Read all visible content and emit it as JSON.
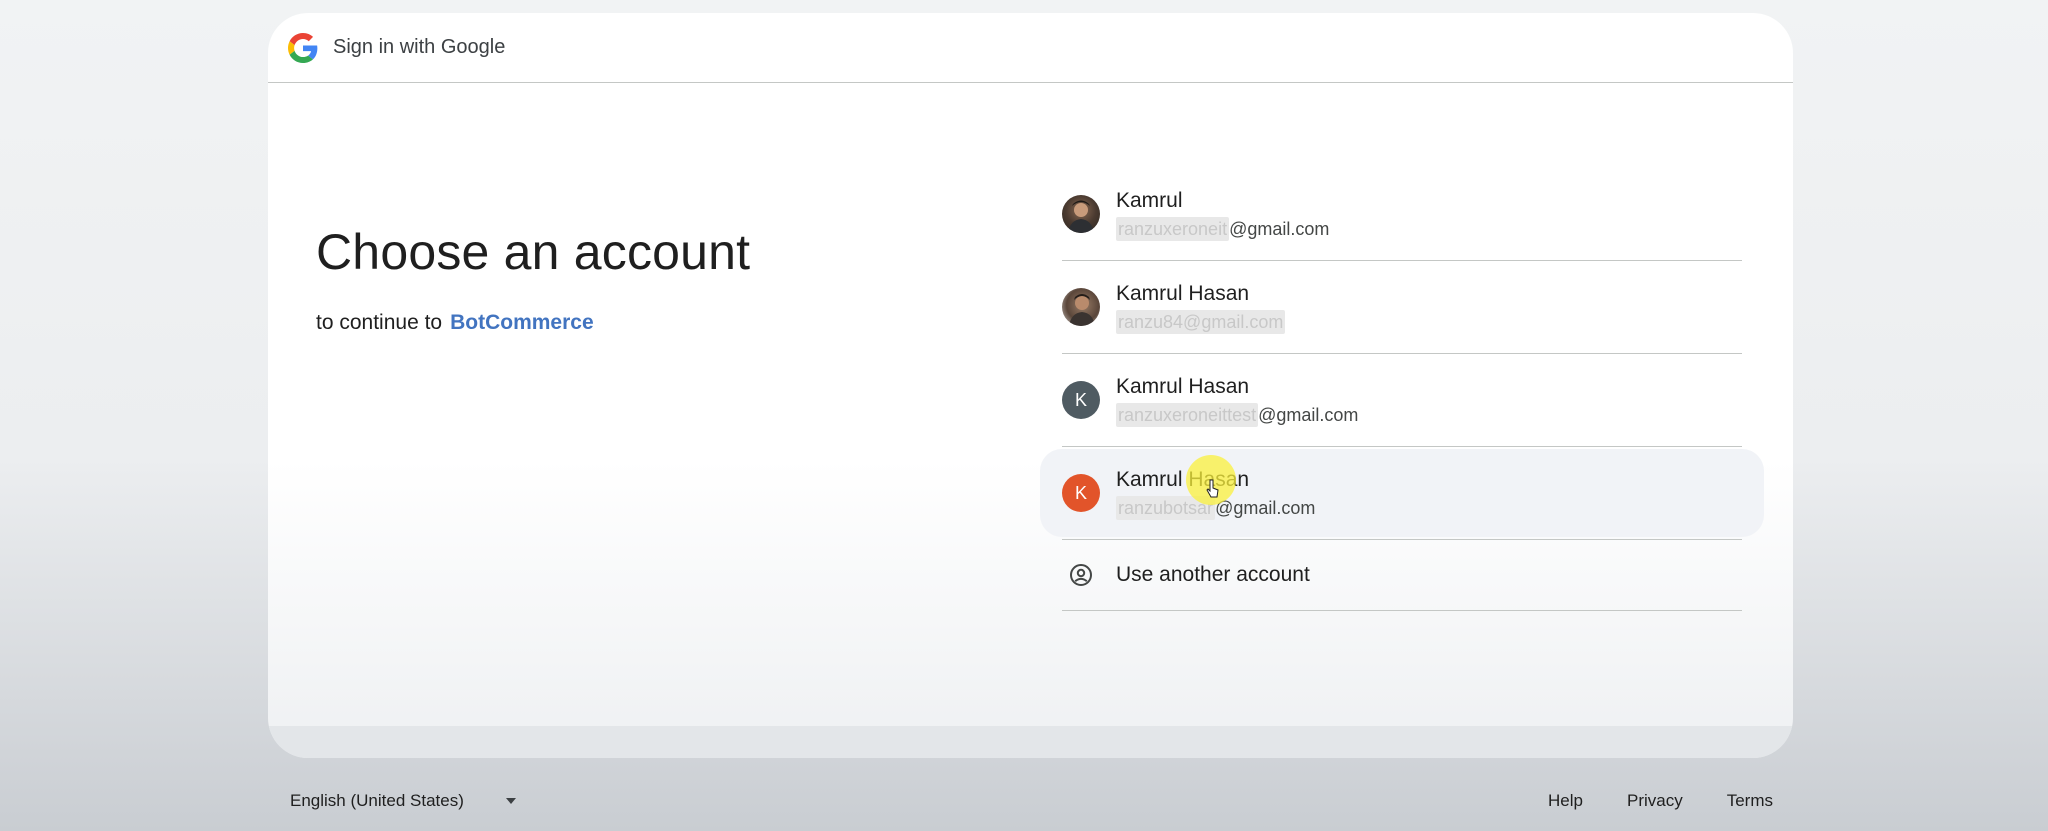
{
  "header": {
    "title": "Sign in with Google",
    "logo_icon": "google-g-icon"
  },
  "main": {
    "title": "Choose an account",
    "subtitle_prefix": "to continue to",
    "app_name": "BotCommerce"
  },
  "accounts": [
    {
      "name": "Kamrul",
      "email_hidden": "ranzuxeroneit",
      "email_visible": "@gmail.com",
      "avatar": "photo"
    },
    {
      "name": "Kamrul Hasan",
      "email_hidden": "ranzu84@gmail.com",
      "email_visible": "",
      "avatar": "photo"
    },
    {
      "name": "Kamrul Hasan",
      "email_hidden": "ranzuxeroneittest",
      "email_visible": "@gmail.com",
      "avatar_letter": "K",
      "avatar_color": "#4f5b62"
    },
    {
      "name": "Kamrul Hasan",
      "email_hidden": "ranzubotsar",
      "email_visible": "@gmail.com",
      "avatar_letter": "K",
      "avatar_color": "#e2542a"
    }
  ],
  "use_another": {
    "label": "Use another account",
    "icon": "account-circle-icon"
  },
  "footer": {
    "language": "English (United States)",
    "links": [
      "Help",
      "Privacy",
      "Terms"
    ]
  },
  "colors": {
    "link": "#4274c0",
    "divider": "#c4c7c5",
    "highlight_row": "#f1f3f7"
  }
}
